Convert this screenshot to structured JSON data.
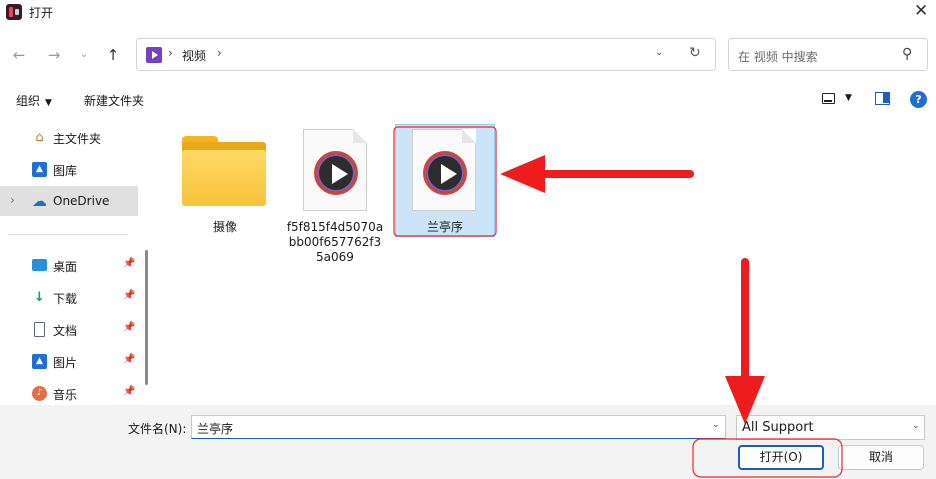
{
  "window": {
    "title": "打开",
    "accent": "#1e5fb4"
  },
  "nav": {
    "back_icon": "arrow-left-icon",
    "forward_icon": "arrow-right-icon",
    "recent_icon": "chevron-down-icon",
    "up_icon": "arrow-up-icon",
    "breadcrumb": [
      "视频"
    ],
    "search_placeholder": "在 视频 中搜索"
  },
  "toolbar": {
    "organize_label": "组织",
    "new_folder_label": "新建文件夹"
  },
  "sidebar": {
    "items": [
      {
        "label": "主文件夹",
        "icon": "home-icon",
        "pinned": false
      },
      {
        "label": "图库",
        "icon": "gallery-icon",
        "pinned": false
      },
      {
        "label": "OneDrive",
        "icon": "cloud-icon",
        "pinned": false,
        "selected": true,
        "expandable": true
      },
      {
        "label": "桌面",
        "icon": "desktop-icon",
        "pinned": true
      },
      {
        "label": "下载",
        "icon": "download-icon",
        "pinned": true
      },
      {
        "label": "文档",
        "icon": "document-icon",
        "pinned": true
      },
      {
        "label": "图片",
        "icon": "pictures-icon",
        "pinned": true
      },
      {
        "label": "音乐",
        "icon": "music-icon",
        "pinned": true
      }
    ]
  },
  "files": [
    {
      "name": "摄像",
      "type": "folder"
    },
    {
      "name_lines": [
        "f5f815f4d5070a",
        "bb00f657762f3",
        "5a069"
      ],
      "type": "video"
    },
    {
      "name": "兰亭序",
      "type": "video",
      "selected": true
    }
  ],
  "footer": {
    "filename_label": "文件名(N):",
    "filename_value": "兰亭序",
    "filetype_value": "All Support",
    "open_label": "打开(O)",
    "cancel_label": "取消"
  },
  "annotation_color": "#ee1c1c"
}
